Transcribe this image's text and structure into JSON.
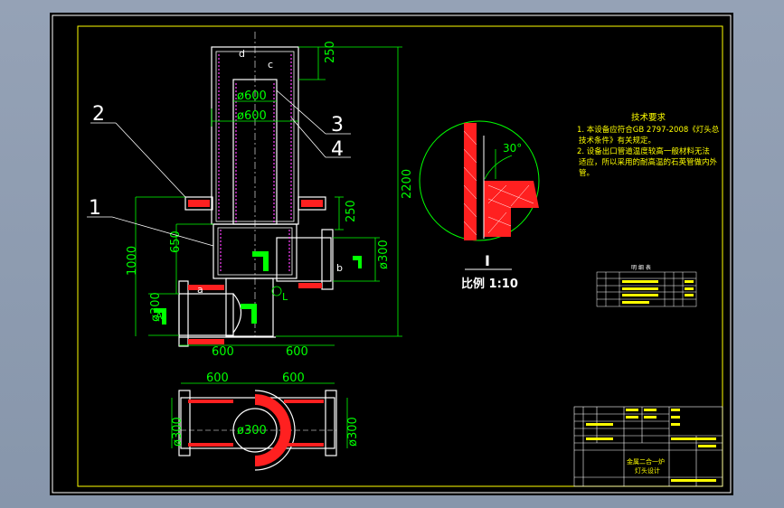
{
  "drawing": {
    "part_numbers": [
      "2",
      "1",
      "3",
      "4"
    ],
    "point_labels": {
      "a": "a",
      "b": "b",
      "c": "c",
      "d": "d",
      "A": "A",
      "L": "L"
    },
    "dimensions": {
      "top_250": "250",
      "dia_600_inner": "ø600",
      "dia_600_outer": "ø600",
      "total_2200": "2200",
      "flange_250": "250",
      "height_1000": "1000",
      "height_650": "650",
      "dia_300_left": "ø300",
      "dia_300_right": "ø300",
      "width_600_left": "600",
      "width_600_right": "600",
      "plan_600_left": "600",
      "plan_600_right": "600",
      "plan_dia_300_left": "ø300",
      "plan_dia_300_right": "ø300",
      "plan_dia_300_center": "ø300"
    },
    "detail": {
      "angle": "30°",
      "roman": "I",
      "scale": "比例 1:10"
    },
    "tech_notes": {
      "title": "技术要求",
      "line1": "1. 本设备应符合GB 2797-2008《灯头总",
      "line2": "技术条件》有关规定。",
      "line3": "2. 设备出口管道温度较高一般材料无法",
      "line4": "适应，所以采用的耐高温的石英管做内外",
      "line5": "管。"
    },
    "small_table": {
      "title": "明 细 表"
    },
    "title_block": {
      "product": "金属二合一炉",
      "part": "灯头设计"
    }
  },
  "colors": {
    "sheet": "#000000",
    "frame": "#ffffff",
    "geometry": "#ffffff",
    "dimension": "#00ff00",
    "text_yellow": "#ffff00",
    "hatch_red": "#ff2020",
    "insulation_magenta": "#ff40ff",
    "leader": "#ffffff",
    "background": "#8e9bae"
  }
}
